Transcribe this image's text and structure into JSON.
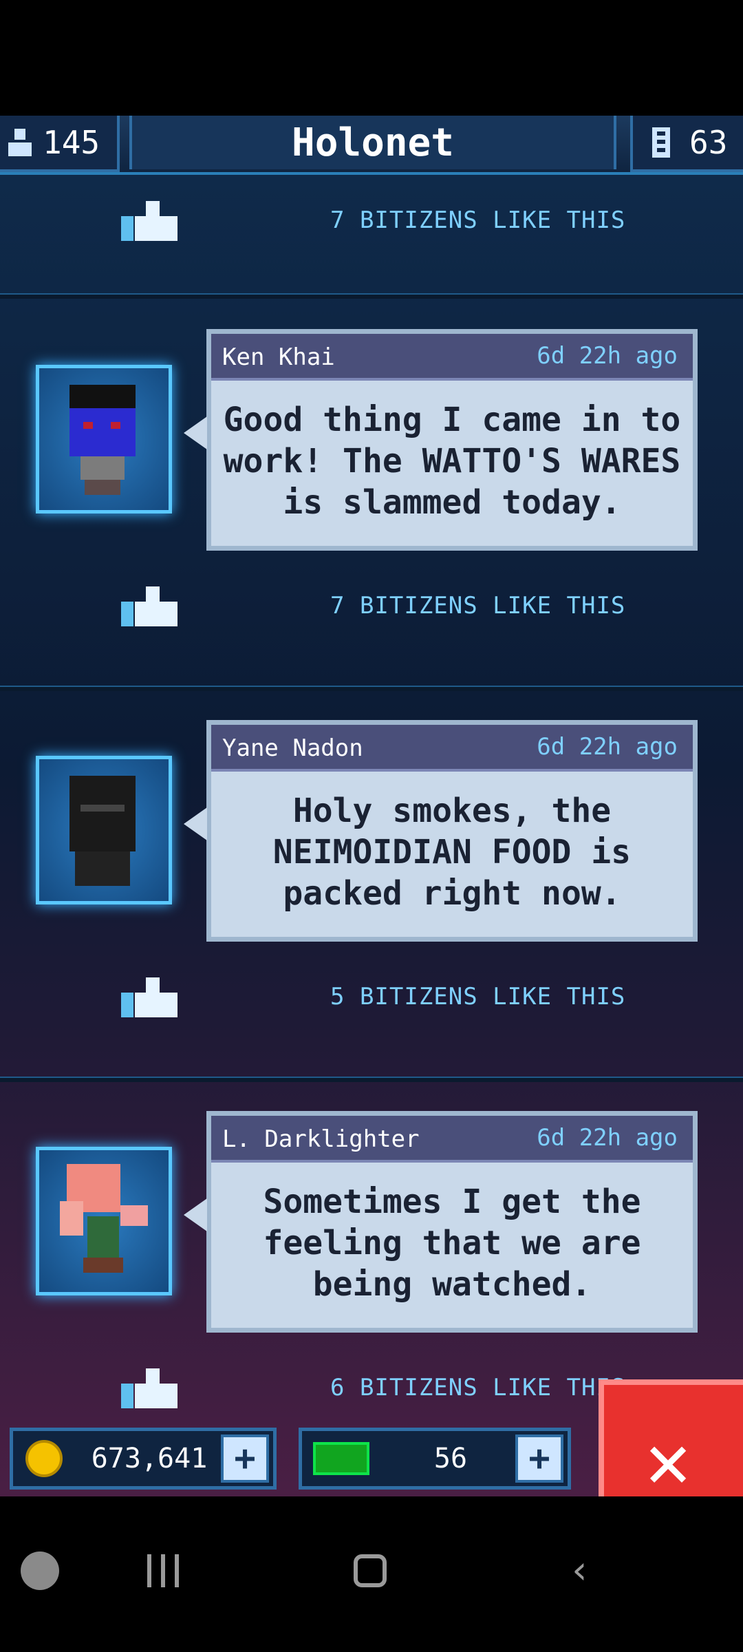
{
  "header": {
    "population": "145",
    "title": "Holonet",
    "floors": "63"
  },
  "posts": [
    {
      "likes": "7 BITIZENS LIKE THIS"
    },
    {
      "author": "Ken Khai",
      "time": "6d 22h ago",
      "message": "Good thing I came in to work! The WATTO'S WARES is slammed today.",
      "likes": "7 BITIZENS LIKE THIS"
    },
    {
      "author": "Yane Nadon",
      "time": "6d 22h ago",
      "message": "Holy smokes, the NEIMOIDIAN FOOD is packed right now.",
      "likes": "5 BITIZENS LIKE THIS"
    },
    {
      "author": "L. Darklighter",
      "time": "6d 22h ago",
      "message": "Sometimes I get the feeling that we are being watched.",
      "likes": "6 BITIZENS LIKE THIS"
    }
  ],
  "resources": {
    "coins": "673,641",
    "bux": "56"
  }
}
